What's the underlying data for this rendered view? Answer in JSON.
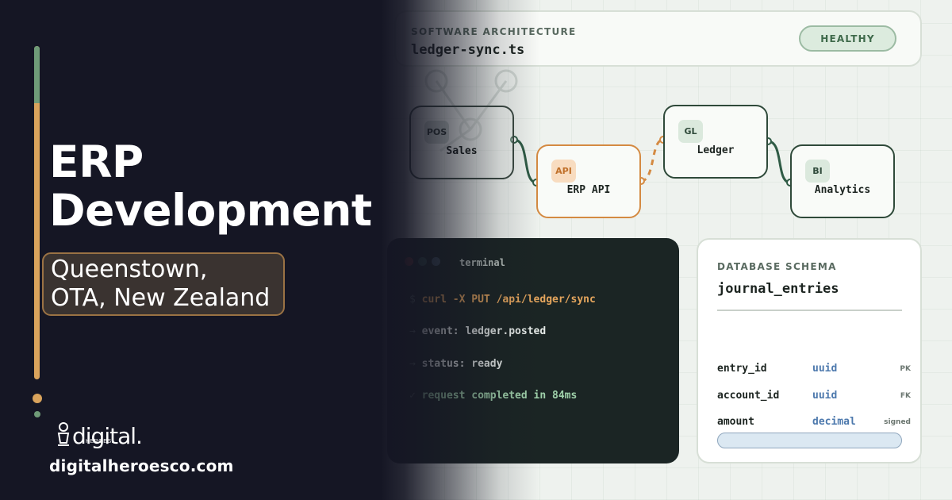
{
  "hero": {
    "title_line1": "ERP",
    "title_line2": "Development",
    "location_line1": "Queenstown,",
    "location_line2": "OTA, New Zealand"
  },
  "brand": {
    "logo_word": "digital.",
    "logo_sub": "HEROES.",
    "website": "digitalheroesco.com"
  },
  "header": {
    "label": "SOFTWARE ARCHITECTURE",
    "file": "ledger-sync.ts",
    "status": "HEALTHY"
  },
  "flow": {
    "nodes": [
      {
        "tag": "POS",
        "label": "Sales"
      },
      {
        "tag": "API",
        "label": "ERP API"
      },
      {
        "tag": "GL",
        "label": "Ledger"
      },
      {
        "tag": "BI",
        "label": "Analytics"
      }
    ]
  },
  "terminal": {
    "title": "terminal",
    "lines": [
      {
        "prefix": "$",
        "text": "curl -X PUT /api/ledger/sync"
      },
      {
        "prefix": "→",
        "text": "event: ledger.posted"
      },
      {
        "prefix": "→",
        "text": "status: ready"
      },
      {
        "prefix": "✓",
        "text": "request completed in 84ms"
      }
    ]
  },
  "schema": {
    "label": "DATABASE SCHEMA",
    "table": "journal_entries",
    "fields": [
      {
        "name": "entry_id",
        "type": "uuid",
        "key": "PK"
      },
      {
        "name": "account_id",
        "type": "uuid",
        "key": "FK"
      },
      {
        "name": "amount",
        "type": "decimal",
        "key": "signed"
      }
    ]
  },
  "colors": {
    "accent_gold": "#d9a35c",
    "accent_green": "#6f9b78",
    "dark_bg": "#151624",
    "api_orange": "#d48a42",
    "type_blue": "#4d79ad"
  }
}
